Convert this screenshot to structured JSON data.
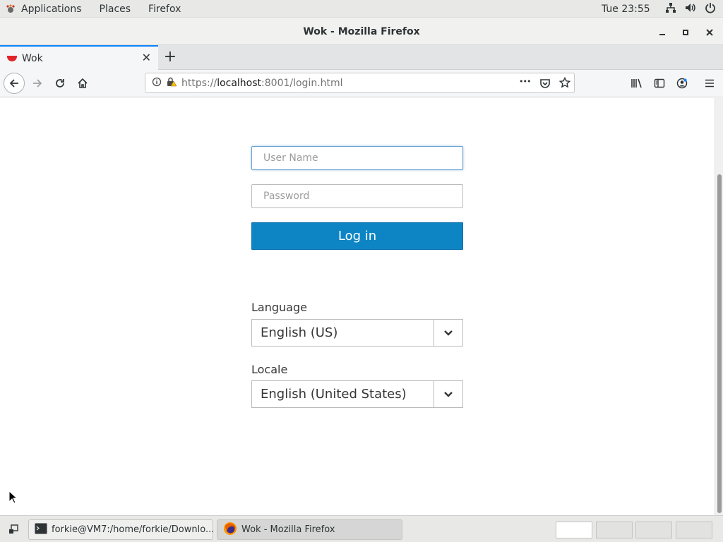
{
  "topbar": {
    "applications": "Applications",
    "places": "Places",
    "firefox": "Firefox",
    "clock": "Tue 23:55"
  },
  "window": {
    "title": "Wok - Mozilla Firefox"
  },
  "tab": {
    "label": "Wok",
    "close": "✕",
    "newtab": "+"
  },
  "navbar": {
    "url_prefix": "https://",
    "url_host": "localhost",
    "url_rest": ":8001/login.html",
    "more": "•••"
  },
  "login": {
    "username_placeholder": "User Name",
    "password_placeholder": "Password",
    "login_label": "Log in",
    "language_label": "Language",
    "language_value": "English (US)",
    "locale_label": "Locale",
    "locale_value": "English (United States)"
  },
  "taskbar": {
    "terminal_label": "forkie@VM7:/home/forkie/Downlo...",
    "firefox_label": "Wok - Mozilla Firefox"
  },
  "colors": {
    "login_button": "#0d85c5",
    "tab_accent": "#0a84ff",
    "favicon": "#e3232b"
  }
}
